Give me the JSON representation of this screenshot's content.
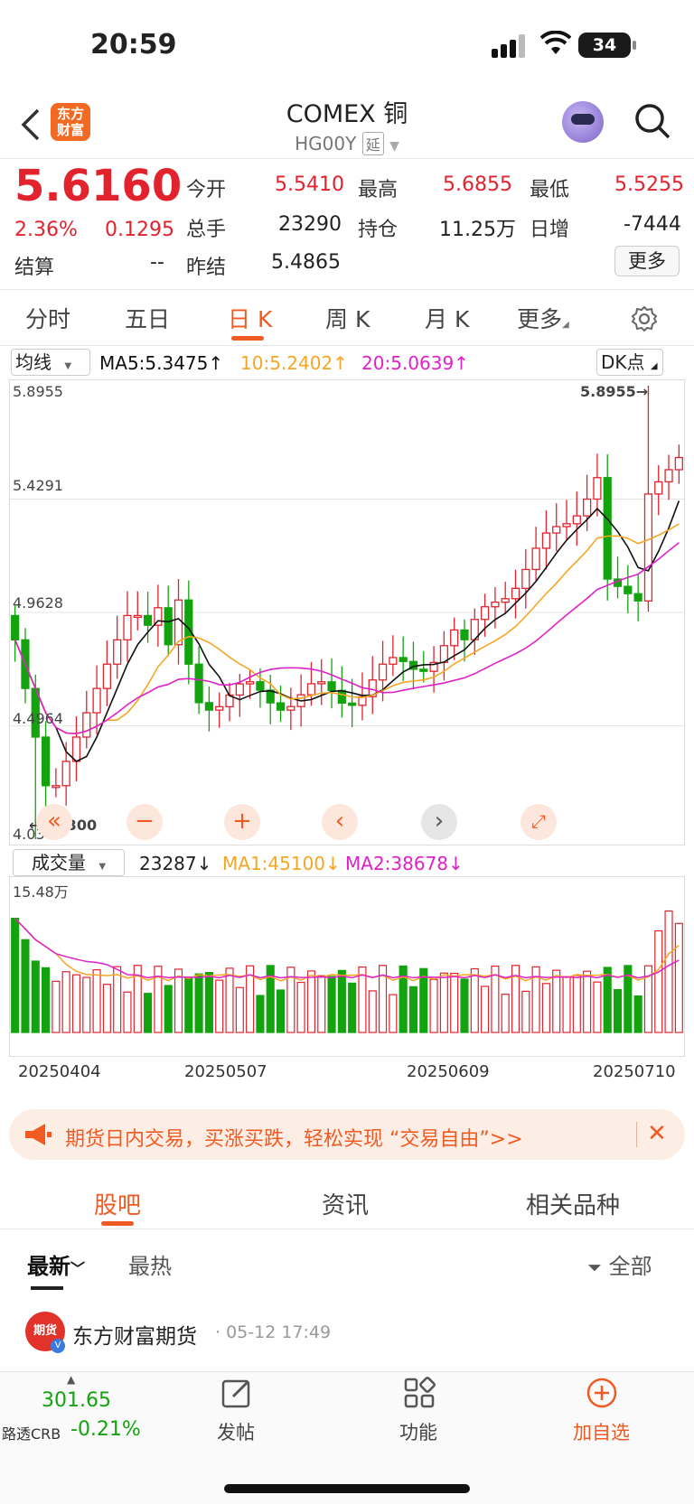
{
  "status": {
    "time": "20:59",
    "battery": "34"
  },
  "header": {
    "back_icon": "chevron-left-icon",
    "logo_text": "东方\n财富",
    "title": "COMEX 铜",
    "code": "HG00Y",
    "delay_tag": "延"
  },
  "quote": {
    "price": "5.6160",
    "change_pct": "2.36%",
    "change": "0.1295",
    "open_label": "今开",
    "open": "5.5410",
    "high_label": "最高",
    "high": "5.6855",
    "low_label": "最低",
    "low": "5.5255",
    "volume_label": "总手",
    "volume": "23290",
    "oi_label": "持仓",
    "oi": "11.25万",
    "daily_inc_label": "日增",
    "daily_inc": "-7444",
    "settle_label": "结算",
    "settle": "--",
    "prev_settle_label": "昨结",
    "prev_settle": "5.4865",
    "more_button": "更多"
  },
  "tabs": [
    {
      "label": "分时"
    },
    {
      "label": "五日"
    },
    {
      "label": "日 K"
    },
    {
      "label": "周 K"
    },
    {
      "label": "月 K"
    },
    {
      "label": "更多"
    }
  ],
  "indicator": {
    "selector": "均线",
    "ma5": "MA5:5.3475↑",
    "ma10": "10:5.2402↑",
    "ma20": "20:5.0639↑",
    "dk": "DK点"
  },
  "chart_data": {
    "type": "candlestick",
    "y_ticks": [
      "5.8955",
      "5.4291",
      "4.9628",
      "4.4964",
      "4.0300"
    ],
    "ylim": [
      4.03,
      5.8955
    ],
    "max_annotation": "5.8955→",
    "min_annotation": "←4.0300",
    "colors": {
      "up": "#e2232d",
      "down": "#12a30e",
      "ma5": "#111111",
      "ma10": "#f5a623",
      "ma20": "#e020c8"
    },
    "volume_selector": "成交量",
    "volume_value": "23287↓",
    "volume_ma1": "MA1:45100↓",
    "volume_ma2": "MA2:38678↓",
    "volume_max": "15.48万",
    "dates": [
      "20250404",
      "20250507",
      "20250609",
      "20250710"
    ]
  },
  "banner": {
    "text": "期货日内交易，买涨买跌，轻松实现 “交易自由”>>"
  },
  "subtabs": [
    {
      "label": "股吧"
    },
    {
      "label": "资讯"
    },
    {
      "label": "相关品种"
    }
  ],
  "sort": {
    "latest": "最新",
    "hot": "最热",
    "filter": "全部"
  },
  "post": {
    "avatar_text": "期货",
    "name": "东方财富期货",
    "time": "· 05-12 17:49"
  },
  "bottom": {
    "index_value": "301.65",
    "index_name": "路透CRB",
    "index_change": "-0.21%",
    "post_label": "发帖",
    "func_label": "功能",
    "watch_label": "加自选"
  }
}
